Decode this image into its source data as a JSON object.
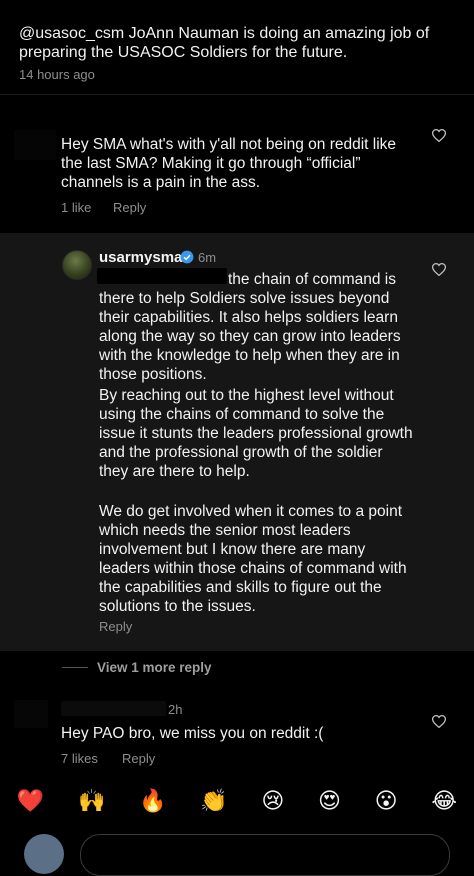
{
  "top_comment": {
    "text": "@usasoc_csm JoAnn Nauman is doing an amazing job of preparing the USASOC Soldiers for the future.",
    "time": "14 hours ago"
  },
  "comment1": {
    "text": "Hey SMA what's with y'all not being on reddit like the last SMA? Making it go through “official” channels is a pain in the ass.",
    "likes": "1 like",
    "reply_label": "Reply"
  },
  "reply": {
    "username": "usarmysma",
    "time": "6m",
    "para1": "the chain of command is there to help Soldiers solve issues beyond their capabilities. It also helps soldiers learn along the way so they can grow into leaders with the knowledge to help when they are in those positions.",
    "para2": "By reaching out to the highest level without using the chains of command to solve the issue it stunts the leaders professional growth and the professional growth of the soldier they are there to help.",
    "para3": "We do get involved when it comes to a point which needs the senior most leaders involvement but I know there are many leaders within those chains of command with the capabilities and skills to figure out the solutions to the issues.",
    "reply_label": "Reply"
  },
  "view_more": "View 1 more reply",
  "comment2": {
    "time": "2h",
    "text": "Hey PAO bro, we miss you on reddit :(",
    "likes": "7 likes",
    "reply_label": "Reply"
  },
  "emoji_bar": [
    "❤️",
    "🙌",
    "🔥",
    "👏",
    "😢",
    "😍",
    "😮",
    "😂"
  ],
  "colors": {
    "background": "#000000",
    "highlight": "#161616",
    "verified": "#3897f0",
    "meta": "#8e8e8e"
  }
}
